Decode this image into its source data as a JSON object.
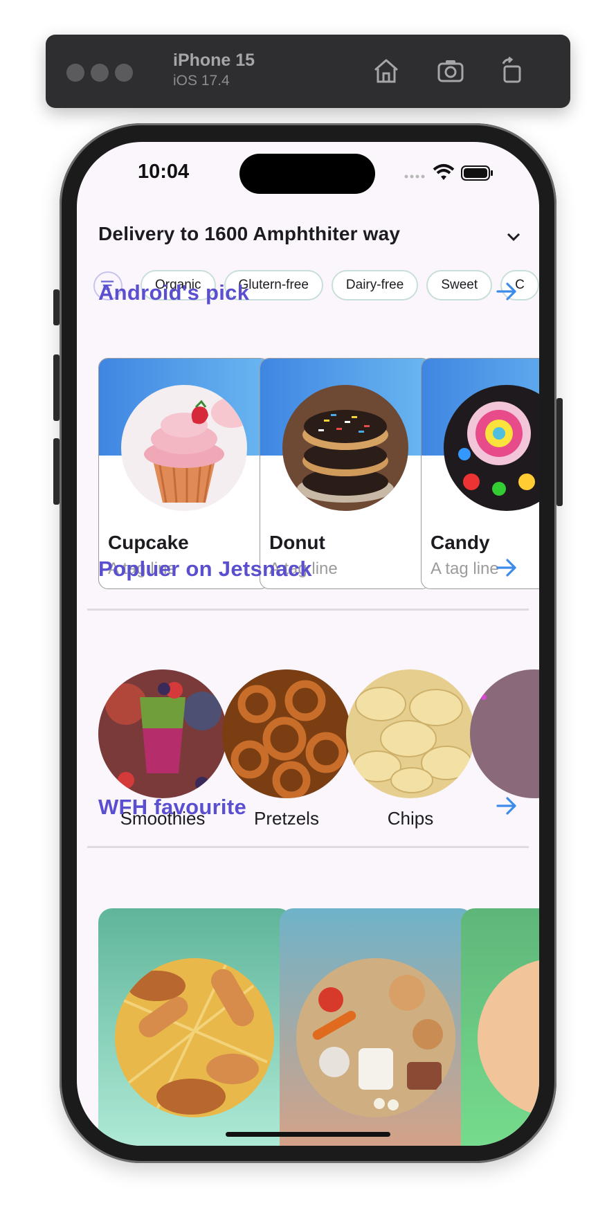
{
  "simulator": {
    "device_name": "iPhone 15",
    "os_version": "iOS 17.4",
    "toolbar_icons": [
      "home-icon",
      "screenshot-icon",
      "rotate-icon"
    ]
  },
  "status_bar": {
    "time": "10:04",
    "icons": [
      "cellular-icon",
      "wifi-icon",
      "battery-icon"
    ]
  },
  "header": {
    "delivery_text": "Delivery to 1600 Amphthiter way"
  },
  "filters": {
    "icon": "filter-icon",
    "chips": [
      "Organic",
      "Glutern-free",
      "Dairy-free",
      "Sweet",
      "C"
    ]
  },
  "sections": {
    "pick": {
      "title": "Android's pick",
      "cards": [
        {
          "name": "Cupcake",
          "tagline": "A tag line"
        },
        {
          "name": "Donut",
          "tagline": "A tag line"
        },
        {
          "name": "Candy",
          "tagline": "A tag line"
        }
      ]
    },
    "popular": {
      "title": "Popluer on Jetsnack",
      "items": [
        "Smoothies",
        "Pretzels",
        "Chips",
        ""
      ]
    },
    "wfh": {
      "title": "WFH favourite",
      "cards": [
        {
          "image": "hotdogs-burgers-image"
        },
        {
          "image": "food-platter-image"
        },
        {
          "image": "food-image"
        }
      ]
    }
  },
  "colors": {
    "accent": "#5a4fcf",
    "arrow": "#3d8be8",
    "screen_bg": "#faf6fc",
    "card_header_from": "#3f86e2",
    "card_header_to": "#6ab7f1"
  }
}
